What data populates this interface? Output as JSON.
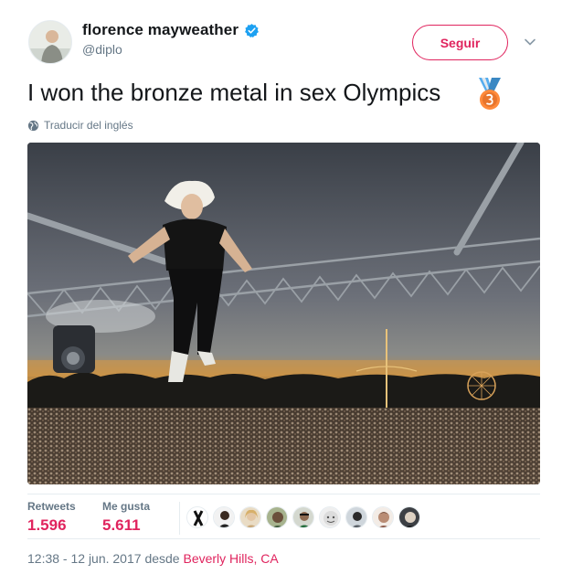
{
  "user": {
    "display_name": "florence mayweather",
    "handle": "@diplo",
    "verified_icon": "verified-badge-icon"
  },
  "follow_button": {
    "label": "Seguir"
  },
  "tweet": {
    "text": "I won the bronze metal in sex Olympics",
    "emoji": "3rd-place-medal-icon",
    "translate_label": "Traducir del inglés"
  },
  "stats": {
    "retweets_label": "Retweets",
    "retweets_count": "1.596",
    "likes_label": "Me gusta",
    "likes_count": "5.611"
  },
  "likers": [
    {
      "avatar": "liker-avatar-1"
    },
    {
      "avatar": "liker-avatar-2"
    },
    {
      "avatar": "liker-avatar-3"
    },
    {
      "avatar": "liker-avatar-4"
    },
    {
      "avatar": "liker-avatar-5"
    },
    {
      "avatar": "liker-avatar-6"
    },
    {
      "avatar": "liker-avatar-7"
    },
    {
      "avatar": "liker-avatar-8"
    },
    {
      "avatar": "liker-avatar-9"
    }
  ],
  "meta": {
    "time": "12:38 - 12 jun. 2017",
    "from_label": "desde",
    "location": "Beverly Hills, CA"
  },
  "colors": {
    "accent": "#e0245e",
    "verified": "#1da1f2",
    "secondary_text": "#657786"
  }
}
